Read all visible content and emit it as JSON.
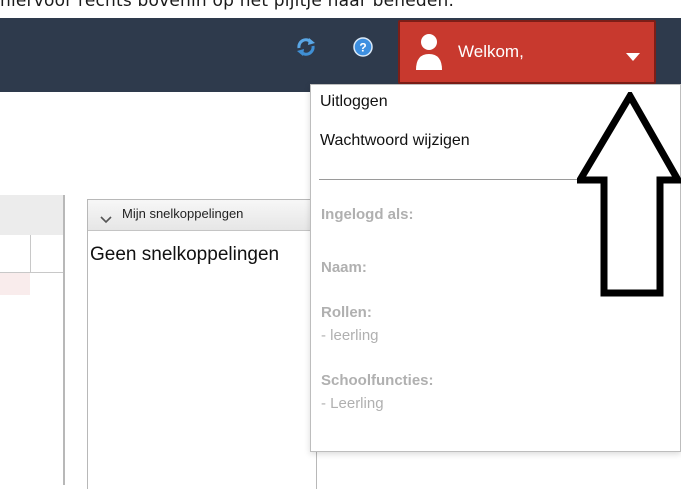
{
  "instruction": {
    "text": "hiervoor rechts bovenin op het pijltje naar beneden."
  },
  "header": {
    "welcome_label": "Welkom,",
    "colors": {
      "bar": "#2e3a4c",
      "welcome_button": "#c8392e"
    },
    "icons": [
      "refresh-icon",
      "help-icon",
      "user-icon",
      "chevron-down-icon"
    ]
  },
  "shortcuts": {
    "title": "Mijn snelkoppelingen",
    "empty_text": "Geen snelkoppelingen"
  },
  "menu": {
    "logout": "Uitloggen",
    "change_password": "Wachtwoord wijzigen",
    "logged_in_as": "Ingelogd als:",
    "name_label": "Naam:",
    "roles_label": "Rollen:",
    "role_value": "- leerling",
    "functions_label": "Schoolfuncties:",
    "function_value": "- Leerling"
  }
}
